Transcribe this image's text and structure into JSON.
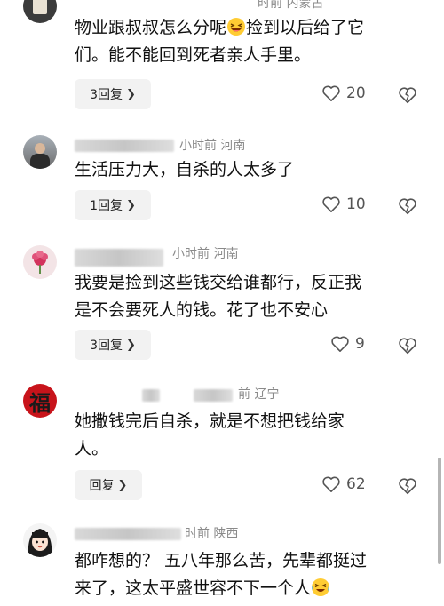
{
  "comments": [
    {
      "meta": "时前  内蒙古",
      "text1": "物业跟叔叔怎么分呢",
      "text2": "捡到以后给了它",
      "text3": "们。能不能回到死者亲人手里。",
      "reply_label": "3回复",
      "likes": "20"
    },
    {
      "meta": "小时前  河南",
      "text1": "生活压力大，自杀的人太多了",
      "reply_label": "1回复",
      "likes": "10"
    },
    {
      "meta": "小时前  河南",
      "text1": "我要是捡到这些钱交给谁都行，反正我",
      "text2": "是不会要死人的钱。花了也不安心",
      "reply_label": "3回复",
      "likes": "9"
    },
    {
      "meta": "前  辽宁",
      "avatar_char": "福",
      "text1": "她撒钱完后自杀，就是不想把钱给家",
      "text2": "人。",
      "reply_label": "回复",
      "likes": "62"
    },
    {
      "meta": "时前  陕西",
      "text1": "都咋想的？ 五八年那么苦，先辈都挺过",
      "text2": "来了，这太平盛世容不下一个人"
    }
  ],
  "icons": {
    "like": "heart-outline-icon",
    "dislike": "broken-heart-icon",
    "chevron": "chevron-right-icon",
    "emoji_laugh": "grinning-squint-emoji-icon",
    "emoji_cry": "crying-laugh-emoji-icon"
  }
}
